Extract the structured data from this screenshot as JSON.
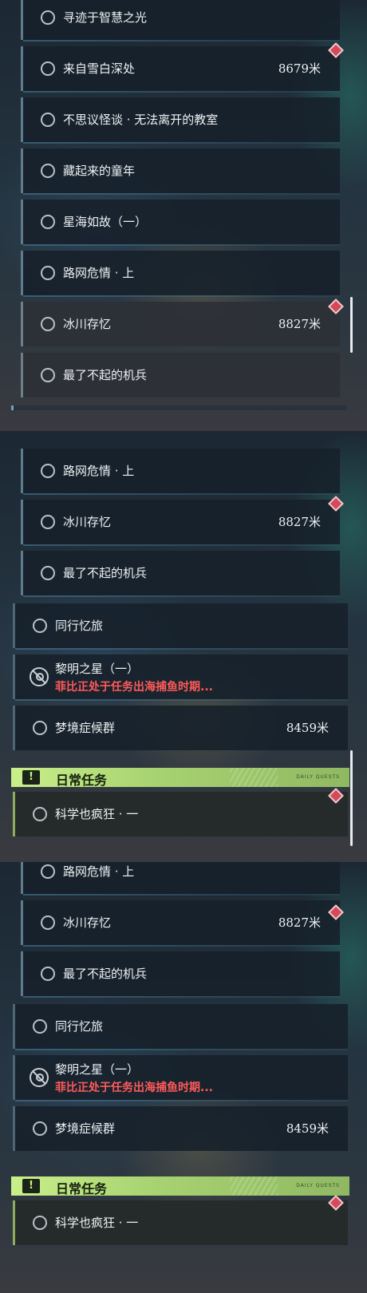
{
  "quests_top": [
    {
      "label": "寻迹于智慧之光"
    },
    {
      "label": "来自雪白深处",
      "distance": "8679米"
    },
    {
      "label": "不思议怪谈 · 无法离开的教室"
    },
    {
      "label": "藏起来的童年"
    },
    {
      "label": "星海如故（一）"
    },
    {
      "label": "路网危情 · 上"
    },
    {
      "label": "冰川存忆",
      "distance": "8827米"
    },
    {
      "label": "最了不起的机兵"
    }
  ],
  "quests_mid": [
    {
      "label": "路网危情 · 上"
    },
    {
      "label": "冰川存忆",
      "distance": "8827米"
    },
    {
      "label": "最了不起的机兵"
    },
    {
      "label": "同行忆旅"
    },
    {
      "label": "黎明之星（一）",
      "status": "菲比正处于任务出海捕鱼时期..."
    },
    {
      "label": "梦境症候群",
      "distance": "8459米"
    }
  ],
  "daily": {
    "icon": "!",
    "title": "日常任务",
    "tag": "DAILY QUESTS",
    "quests": [
      {
        "label": "科学也疯狂 · 一"
      }
    ]
  },
  "colors": {
    "accent_green": "#c9ef8a",
    "marker_red": "#d44a5a",
    "warning_text": "#ff5a5a"
  }
}
